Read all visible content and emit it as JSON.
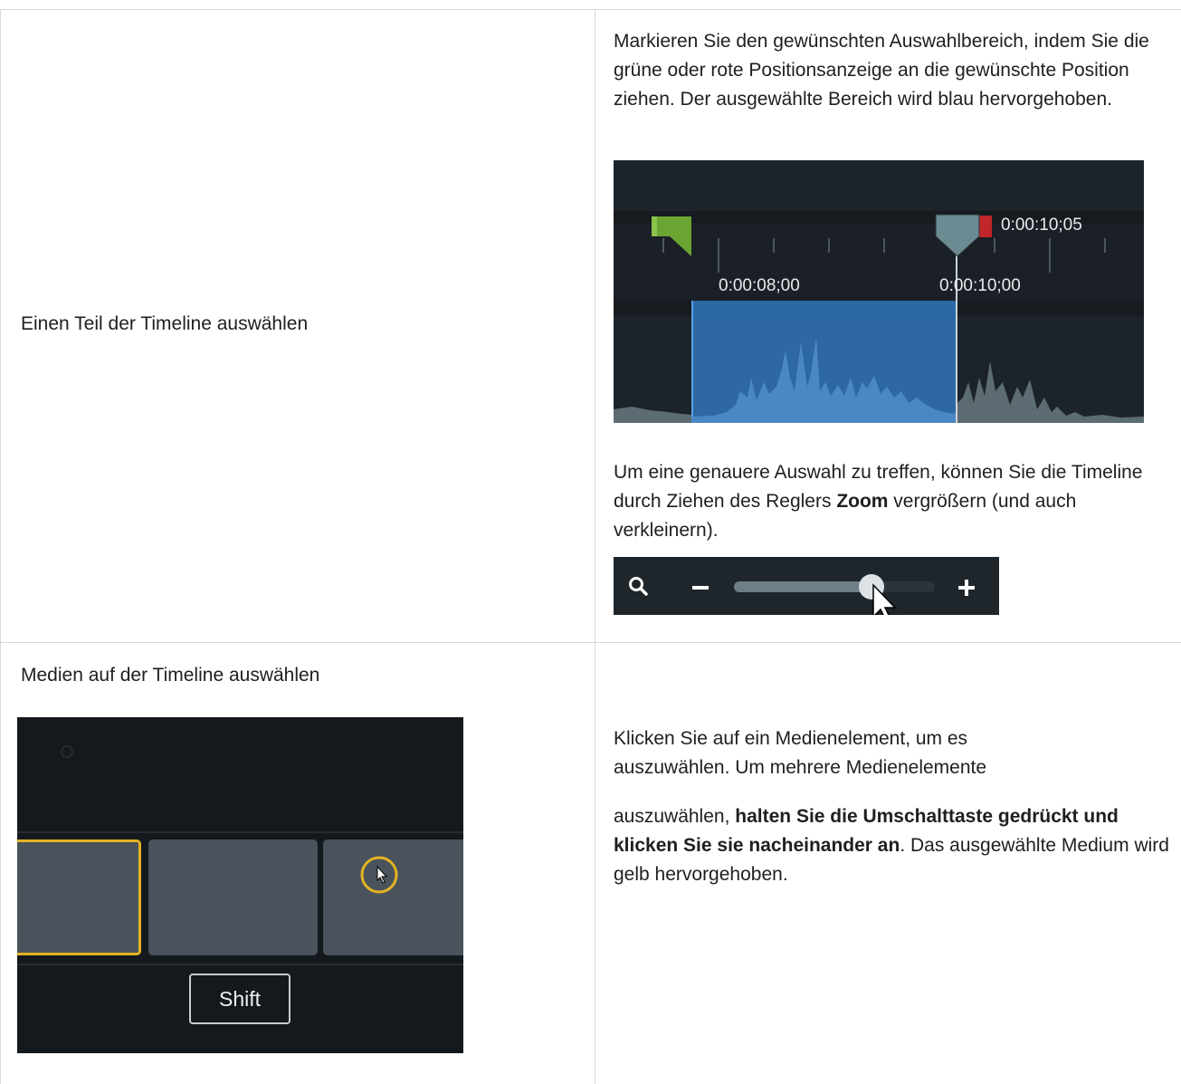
{
  "row1": {
    "title": "Einen Teil der Timeline auswählen",
    "paragraph1": "Markieren Sie den gewünschten Auswahlbereich, indem Sie die grüne oder rote Positionsanzeige an die gewünschte Position ziehen. Der ausgewählte Bereich wird blau hervorgehoben.",
    "timeline": {
      "playhead_time": "0:00:10;05",
      "ruler_label_1": "0:00:08;00",
      "ruler_label_2": "0:00:10;00"
    },
    "paragraph2_part1": "Um eine genauere Auswahl zu treffen, können Sie die Timeline durch Ziehen des Reglers ",
    "paragraph2_bold": "Zoom",
    "paragraph2_part2": " vergrößern (und auch verkleinern).",
    "zoom_slider_value": 0.7
  },
  "row2": {
    "title": "Medien auf der Timeline auswählen",
    "key_label": "Shift",
    "paragraph_line1": "Klicken Sie auf ein Medienelement, um es auszuwählen. Um mehrere Medienelemente",
    "paragraph2_part1": "auszuwählen, ",
    "paragraph2_bold": "halten Sie die Umschalttaste gedrückt und klicken Sie sie nacheinander an",
    "paragraph2_part2": ". Das ausgewählte Medium wird gelb hervorgehoben."
  },
  "colors": {
    "selection_blue": "#2f6fb0",
    "in_marker_green": "#6ba531",
    "out_marker_red": "#c0262c",
    "selected_media_yellow": "#e3b324"
  }
}
